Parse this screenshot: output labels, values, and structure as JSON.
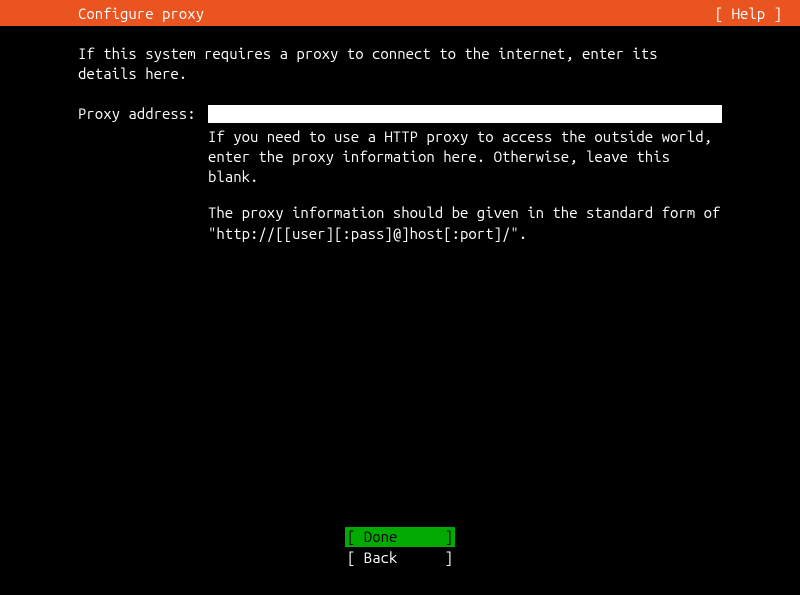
{
  "header": {
    "title": "Configure proxy",
    "help": "[ Help ]"
  },
  "intro": "If this system requires a proxy to connect to the internet, enter its details here.",
  "form": {
    "proxy_label": "Proxy address:",
    "proxy_value": "",
    "help1": "If you need to use a HTTP proxy to access the outside world, enter the proxy information here. Otherwise, leave this blank.",
    "help2": "The proxy information should be given in the standard form of \"http://[[user][:pass]@]host[:port]/\"."
  },
  "footer": {
    "done_open": "[ ",
    "done_label": "Done",
    "done_close": "]",
    "back_open": "[ ",
    "back_label": "Back",
    "back_close": "]"
  }
}
